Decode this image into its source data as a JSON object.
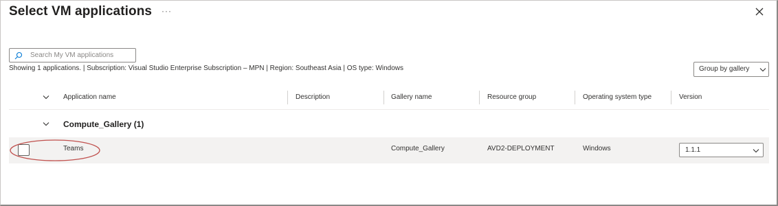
{
  "panel": {
    "title": "Select VM applications",
    "more_label": "···"
  },
  "search": {
    "placeholder": "Search My VM applications"
  },
  "summary": "Showing 1 applications. | Subscription: Visual Studio Enterprise Subscription – MPN | Region: Southeast Asia | OS type: Windows",
  "group_by": {
    "label": "Group by gallery"
  },
  "table": {
    "columns": [
      {
        "label": "Application name"
      },
      {
        "label": "Description"
      },
      {
        "label": "Gallery name"
      },
      {
        "label": "Resource group"
      },
      {
        "label": "Operating system type"
      },
      {
        "label": "Version"
      }
    ],
    "group": {
      "label": "Compute_Gallery (1)"
    },
    "rows": [
      {
        "application_name": "Teams",
        "description": "",
        "gallery_name": "Compute_Gallery",
        "resource_group": "AVD2-DEPLOYMENT",
        "os_type": "Windows",
        "version": "1.1.1",
        "selected": false
      }
    ]
  },
  "icons": {
    "close": "close-icon",
    "search": "search-icon",
    "chevron": "chevron-down-icon"
  },
  "colors": {
    "annotation_oval": "#c0504d",
    "row_highlight": "#f3f2f1",
    "border": "#8a8886"
  }
}
